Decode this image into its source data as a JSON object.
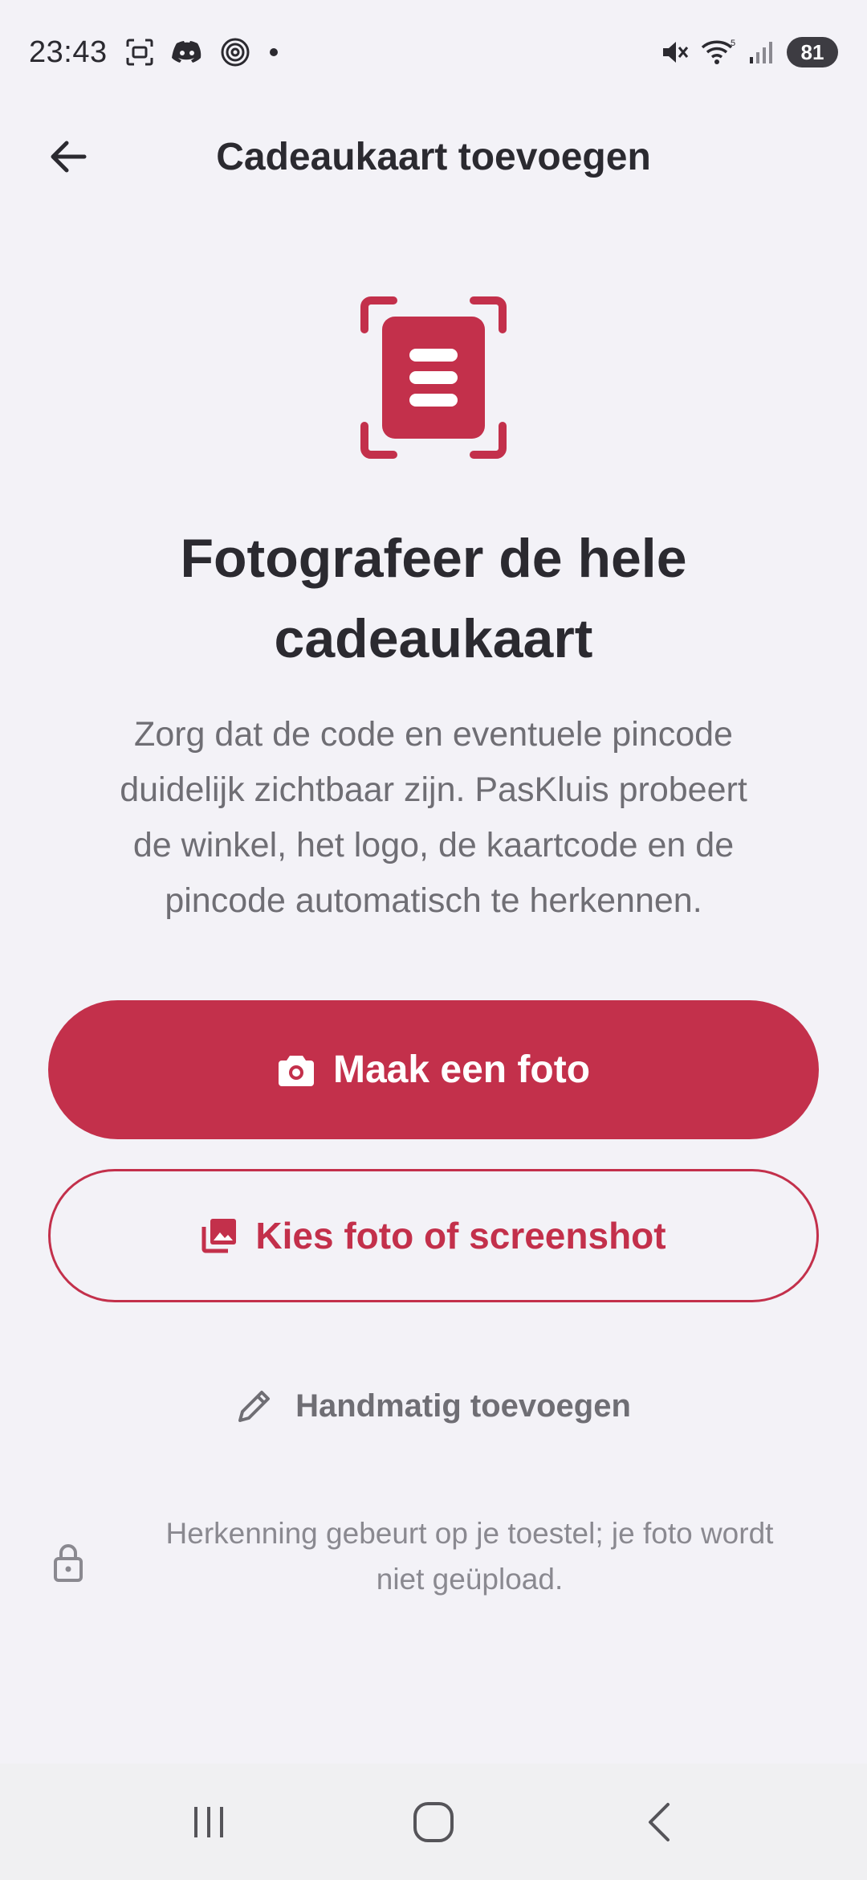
{
  "status_bar": {
    "time": "23:43",
    "battery": "81",
    "icons_left": [
      "screenshot-icon",
      "discord-icon",
      "fingerprint-icon",
      "dot-icon"
    ],
    "icons_right": [
      "mute-icon",
      "wifi-icon",
      "signal-icon"
    ]
  },
  "app_bar": {
    "title": "Cadeaukaart toevoegen",
    "back_icon": "arrow-left-icon"
  },
  "main": {
    "hero_icon": "scan-document-icon",
    "headline_line1": "Fotografeer de hele",
    "headline_line2": "cadeaukaart",
    "description_lines": [
      "Zorg dat de code en eventuele pincode",
      "duidelijk zichtbaar zijn. PasKluis probeert",
      "de winkel, het logo, de kaartcode en de",
      "pincode automatisch te herkennen."
    ],
    "primary_button": {
      "label": "Maak een foto",
      "icon": "camera-icon"
    },
    "secondary_button": {
      "label": "Kies foto of screenshot",
      "icon": "photo-library-icon"
    },
    "manual_link": {
      "label": "Handmatig toevoegen",
      "icon": "pencil-icon"
    },
    "privacy": {
      "icon": "lock-icon",
      "line1": "Herkenning gebeurt op je toestel; je foto wordt",
      "line2": "niet geüpload."
    }
  },
  "nav_bar": {
    "buttons": [
      "recents-icon",
      "home-icon",
      "back-icon"
    ]
  },
  "colors": {
    "accent": "#c3304b",
    "background": "#f3f2f7",
    "text_primary": "#2b2a30",
    "text_secondary": "#6f6e74"
  }
}
